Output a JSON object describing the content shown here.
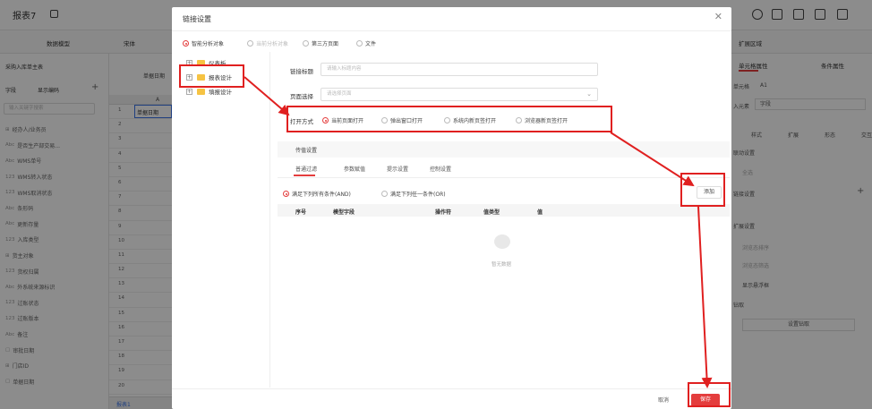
{
  "app": {
    "title": "报表7"
  },
  "toolbar": {
    "data_model": "数据模型",
    "font": "宋体"
  },
  "left_panel": {
    "title": "采购入库单主表",
    "field_label": "字段",
    "show_code": "显示编码",
    "search_placeholder": "输入关键字搜索",
    "items": [
      {
        "tag": "⊞",
        "label": "经办人/业务员"
      },
      {
        "tag": "Abc",
        "label": "是否生产部交易..."
      },
      {
        "tag": "Abc",
        "label": "WMS单号"
      },
      {
        "tag": "123",
        "label": "WMS转入状态"
      },
      {
        "tag": "123",
        "label": "WMS取消状态"
      },
      {
        "tag": "Abc",
        "label": "条形码"
      },
      {
        "tag": "Abc",
        "label": "更新存量"
      },
      {
        "tag": "123",
        "label": "入库类型"
      },
      {
        "tag": "⊞",
        "label": "货主对象"
      },
      {
        "tag": "123",
        "label": "货权归属"
      },
      {
        "tag": "Abc",
        "label": "外系统来源标识"
      },
      {
        "tag": "123",
        "label": "过账状态"
      },
      {
        "tag": "123",
        "label": "过账版本"
      },
      {
        "tag": "Abc",
        "label": "备注"
      },
      {
        "tag": "▢",
        "label": "审批日期"
      },
      {
        "tag": "⊞",
        "label": "门店ID"
      },
      {
        "tag": "▢",
        "label": "单据日期"
      }
    ]
  },
  "grid": {
    "header_label": "单据日期",
    "col_a": "A",
    "cell_a1": "单据日期",
    "rows": [
      "1",
      "2",
      "3",
      "4",
      "5",
      "6",
      "7",
      "8",
      "9",
      "10",
      "11",
      "12",
      "13",
      "14",
      "15",
      "16",
      "17",
      "18",
      "19",
      "20"
    ],
    "sheet_tab": "报表1"
  },
  "right_panel": {
    "area_title": "扩展区域",
    "tab_cell": "单元格属性",
    "tab_cond": "条件属性",
    "cell_label": "单元格",
    "cell_value": "A1",
    "element_label": "入元素",
    "element_value": "字段",
    "subtabs": [
      "样式",
      "扩展",
      "形态",
      "交互"
    ],
    "link_settings_top": "联动设置",
    "all": "全选",
    "link_settings": "链接设置",
    "expand_settings": "扩展设置",
    "sort_opt": "浏览态排序",
    "filter_opt": "浏览态筛选",
    "show_float": "显示悬浮框",
    "drill": "钻取",
    "set_drill": "设置钻取"
  },
  "dialog": {
    "title": "链接设置",
    "close": "✕",
    "source_options": [
      {
        "label": "智能分析对象",
        "selected": true,
        "disabled": false
      },
      {
        "label": "当前分析对象",
        "selected": false,
        "disabled": true
      },
      {
        "label": "第三方页面",
        "selected": false,
        "disabled": false
      },
      {
        "label": "文件",
        "selected": false,
        "disabled": false
      }
    ],
    "tree": [
      {
        "label": "仪表板"
      },
      {
        "label": "报表设计"
      },
      {
        "label": "填报设计"
      }
    ],
    "link_title_label": "链接标题",
    "link_title_placeholder": "请输入标题内容",
    "page_select_label": "页面选择",
    "page_select_placeholder": "请选择页面",
    "open_mode_label": "打开方式",
    "open_modes": [
      {
        "label": "当前页面打开",
        "selected": true
      },
      {
        "label": "弹出窗口打开",
        "selected": false
      },
      {
        "label": "系统内新页签打开",
        "selected": false
      },
      {
        "label": "浏览器新页签打开",
        "selected": false
      }
    ],
    "param_section": "传值设置",
    "param_tabs": [
      "普通过滤",
      "参数赋值",
      "提示设置",
      "控制设置"
    ],
    "match_all": "满足下列所有条件(AND)",
    "match_any": "满足下列任一条件(OR)",
    "add_button": "添加",
    "table_headers": [
      "序号",
      "模型字段",
      "操作符",
      "值类型",
      "值"
    ],
    "empty_text": "暂无数据",
    "cancel_button": "取消",
    "save_button": "保存"
  },
  "colors": {
    "accent": "#e43d3d",
    "annotation": "#e02020",
    "folder": "#f6c343"
  }
}
